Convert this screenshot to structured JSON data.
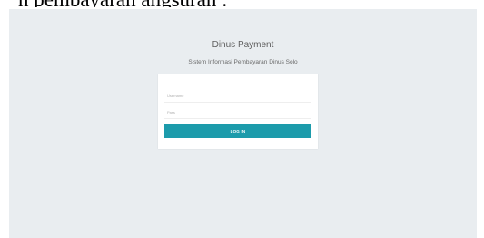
{
  "caption": {
    "text": "n pembayaran angsuran :"
  },
  "app": {
    "title": "Dinus Payment",
    "subtitle": "Sistem Informasi Pembayaran Dinus Solo"
  },
  "login_form": {
    "username": {
      "value": "",
      "placeholder": "Username"
    },
    "password": {
      "value": "",
      "placeholder": "Pass"
    },
    "submit_label": "LOG IN"
  },
  "colors": {
    "page_background": "#e9edf0",
    "card_background": "#ffffff",
    "button_background": "#1c9bab",
    "button_text": "#ffffff"
  }
}
